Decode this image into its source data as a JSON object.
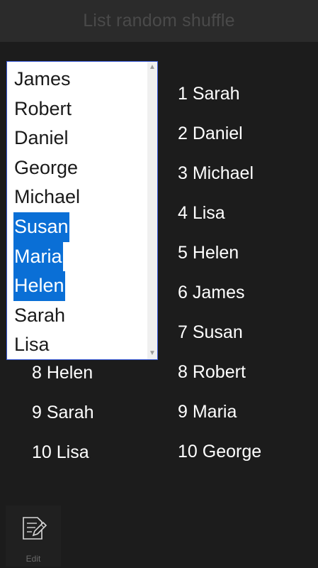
{
  "title": "List random shuffle",
  "listbox": {
    "items": [
      {
        "label": "James",
        "selected": false
      },
      {
        "label": "Robert",
        "selected": false
      },
      {
        "label": "Daniel",
        "selected": false
      },
      {
        "label": "George",
        "selected": false
      },
      {
        "label": "Michael",
        "selected": false
      },
      {
        "label": "Susan",
        "selected": true
      },
      {
        "label": "Maria",
        "selected": true
      },
      {
        "label": "Helen",
        "selected": true
      },
      {
        "label": "Sarah",
        "selected": false
      },
      {
        "label": "Lisa",
        "selected": false
      }
    ],
    "scroll_up_icon": "chevron-up-icon",
    "scroll_down_icon": "chevron-down-icon"
  },
  "left_list": {
    "visible_items": [
      "8 Helen",
      "9 Sarah",
      "10 Lisa"
    ]
  },
  "right_list": {
    "items": [
      "1 Sarah",
      "2 Daniel",
      "3 Michael",
      "4 Lisa",
      "5 Helen",
      "6 James",
      "7 Susan",
      "8 Robert",
      "9 Maria",
      "10 George"
    ]
  },
  "bottom_bar": {
    "edit_label": "Edit",
    "edit_icon": "edit-icon"
  },
  "colors": {
    "background": "#1c1c1c",
    "titlebar": "#2b2b2b",
    "selection": "#0a6fd6",
    "listbox_border": "#3a5bd9"
  }
}
